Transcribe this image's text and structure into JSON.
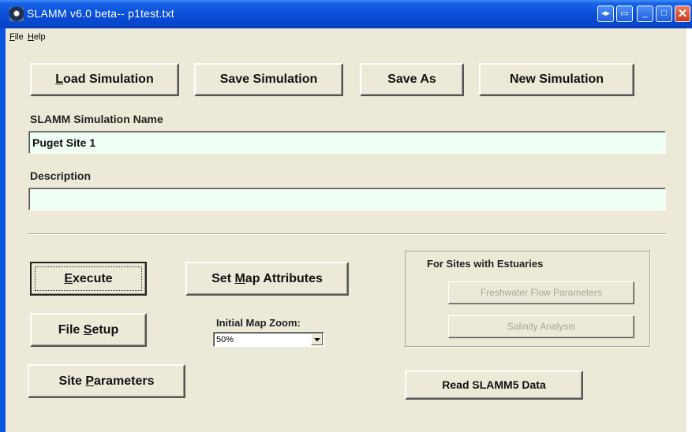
{
  "window": {
    "title": "SLAMM v6.0 beta--  p1test.txt",
    "controls": {
      "extra1": "◂▸",
      "extra2": "▭",
      "minimize": "_",
      "maximize": "□",
      "close": "✕"
    }
  },
  "menu": {
    "file_first": "F",
    "file_rest": "ile",
    "help_first": "H",
    "help_rest": "elp"
  },
  "toolbar": {
    "load_first": "L",
    "load_rest": "oad Simulation",
    "save_label": "Save Simulation",
    "save_as_label": "Save As",
    "new_label": "New Simulation"
  },
  "simulation": {
    "name_label": "SLAMM Simulation Name",
    "name_value": "Puget Site 1",
    "description_label": "Description",
    "description_value": ""
  },
  "actions": {
    "execute_first": "E",
    "execute_rest": "xecute",
    "map_attr_pre": "Set ",
    "map_attr_u": "M",
    "map_attr_post": "ap Attributes",
    "file_setup_pre": "File ",
    "file_setup_u": "S",
    "file_setup_post": "etup",
    "site_params_pre": "Site ",
    "site_params_u": "P",
    "site_params_post": "arameters",
    "zoom_label": "Initial Map Zoom:",
    "zoom_value": "50%",
    "read_slamm5": "Read SLAMM5 Data"
  },
  "estuaries": {
    "title": "For Sites with Estuaries",
    "freshwater": "Freshwater Flow Parameters",
    "salinity": "Salinity Analysis"
  }
}
